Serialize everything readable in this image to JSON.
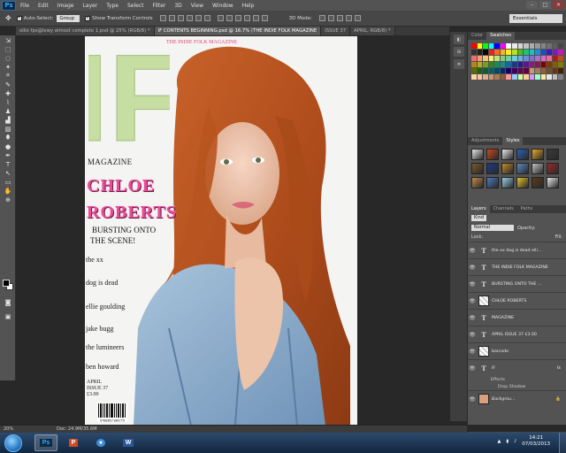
{
  "app": {
    "logo": "Ps",
    "menu": [
      "File",
      "Edit",
      "Image",
      "Layer",
      "Type",
      "Select",
      "Filter",
      "3D",
      "View",
      "Window",
      "Help"
    ],
    "window_controls": [
      "–",
      "□",
      "✕"
    ]
  },
  "options_bar": {
    "auto_select_label": "Auto-Select:",
    "auto_select_value": "Group",
    "show_transform_label": "Show Transform Controls",
    "mode_3d_label": "3D Mode:",
    "workspace": "Essentials"
  },
  "doc_tabs": [
    {
      "label": "ollie fps@lewy  almost complete 1.psd @ 25% (RGB/8) *",
      "active": false
    },
    {
      "label": "IF CONTENTS BEGINNING.psd @ 16.7% (THE INDIE FOLK MAGAZINE",
      "active": true
    },
    {
      "label": "ISSUE 37",
      "active": false
    },
    {
      "label": "APRIL, RGB/8) *",
      "active": false
    }
  ],
  "tools": [
    "⇲",
    "⬚",
    "◌",
    "✦",
    "⌗",
    "✎",
    "✚",
    "⌇",
    "♟",
    "▟",
    "▨",
    "⬮",
    "●",
    "✒",
    "T",
    "↖",
    "▭",
    "✋",
    "⊕"
  ],
  "magazine": {
    "logo_text": "IF",
    "masthead": "MAGAZINE",
    "strapline": "THE INDIE FOLK MAGAZINE",
    "cover_name_1": "CHLOE",
    "cover_name_2": "ROBERTS",
    "bursting_1": "BURSTING ONTO",
    "bursting_2": "THE SCENE!",
    "bands": [
      "the xx",
      "dog is dead",
      "ellie goulding",
      "jake bugg",
      "the lumineers",
      "ben howard"
    ],
    "issue_month": "APRIL",
    "issue_number": "ISSUE 37",
    "price": "£3.00",
    "barcode_number": "9780857186775"
  },
  "status": {
    "zoom": "20%",
    "doc_size": "Doc: 24.9M/35.6M"
  },
  "mini_dock": [
    "◧",
    "⊞",
    "≣"
  ],
  "panels": {
    "color_tabs": [
      "Color",
      "Swatches"
    ],
    "swatch_colors": [
      "#ff0000",
      "#ffff00",
      "#00ff00",
      "#00ffff",
      "#0000ff",
      "#ff00ff",
      "#ffffff",
      "#ebebeb",
      "#d6d6d6",
      "#c2c2c2",
      "#adadad",
      "#999999",
      "#858585",
      "#707070",
      "#5c5c5c",
      "#474747",
      "#333333",
      "#1f1f1f",
      "#000000",
      "#ff1a1a",
      "#ff6b1a",
      "#ffb31a",
      "#fff21a",
      "#b8e31a",
      "#46c21a",
      "#1ac27a",
      "#1ac2c2",
      "#1a8ee3",
      "#1a4ec2",
      "#3a1ac2",
      "#7a1ac2",
      "#c21ab8",
      "#f26c6c",
      "#f5a06c",
      "#f7c46c",
      "#f8ef6c",
      "#c4e27a",
      "#84cf7a",
      "#6ecfa8",
      "#6cd1d1",
      "#6cb1e6",
      "#6c8ed8",
      "#866cd2",
      "#b06cd0",
      "#d86cc2",
      "#e86c9a",
      "#b31a1a",
      "#b3531a",
      "#b3851a",
      "#b3ad1a",
      "#7a9e1a",
      "#2d8a1a",
      "#1a8a56",
      "#1a8a8a",
      "#1a679e",
      "#1a3a8a",
      "#2c1a8a",
      "#561a8a",
      "#8a1a82",
      "#8a1a52",
      "#800000",
      "#803c00",
      "#806000",
      "#807c00",
      "#566f00",
      "#1f6100",
      "#00613c",
      "#006161",
      "#004a6f",
      "#002a61",
      "#1e0061",
      "#3c0061",
      "#61005a",
      "#610039",
      "#c69c6d",
      "#a67c52",
      "#8c6239",
      "#754c24",
      "#603913",
      "#42210b",
      "#ffd5a6",
      "#f5c69e",
      "#e0b08a",
      "#c8966e",
      "#a87a55",
      "#8a5f3e",
      "#ff9999",
      "#99ccff",
      "#ccff99",
      "#ffcc99",
      "#cc99ff",
      "#99ffcc",
      "#ffe699",
      "#e6e6e6",
      "#bfbfbf",
      "#808080"
    ],
    "styles_tabs": [
      "Adjustments",
      "Styles"
    ],
    "style_colors": [
      "#e8e8e8",
      "#d2451e",
      "#e8e8e8",
      "#2a62b5",
      "#e8a82a",
      "#3a3a3a",
      "#7a5a2a",
      "#1a3a8a",
      "#c28a2a",
      "#5a8ac2",
      "#c2c2c2",
      "#9a2a2a",
      "#c28a4a",
      "#4a7ac2",
      "#9ad2e8",
      "#e8c22a",
      "#5a3a1a",
      "#e8e8e8"
    ],
    "layers_tabs": [
      "Layers",
      "Channels",
      "Paths"
    ],
    "layer_filter": "Kind",
    "blend_mode": "Normal",
    "opacity_label": "Opacity:",
    "lock_label": "Lock:",
    "fill_label": "Fill:",
    "layers": [
      {
        "name": "the xx  dog is dead  elli...",
        "type": "text"
      },
      {
        "name": "THE INDIE FOLK MAGAZINE",
        "type": "text"
      },
      {
        "name": "BURSTING ONTO THE ...",
        "type": "text"
      },
      {
        "name": "CHLOE ROBERTS",
        "type": "checker"
      },
      {
        "name": "MAGAZINE",
        "type": "text"
      },
      {
        "name": "APRIL ISSUE 37 £3.00",
        "type": "text"
      },
      {
        "name": "barcode",
        "type": "checker"
      },
      {
        "name": "IF",
        "type": "text",
        "fx": "fx"
      }
    ],
    "effects_label": "Effects",
    "drop_shadow_label": "Drop Shadow",
    "background_layer": "Backgrou..."
  },
  "taskbar": {
    "apps": [
      {
        "label": "Ps",
        "color": "#31a8ff",
        "bg": "#0f2b44"
      },
      {
        "label": "P",
        "color": "#ffffff",
        "bg": "#d24726"
      },
      {
        "label": "●",
        "color": "#ffffff",
        "bg": "#3d8ed6"
      },
      {
        "label": "W",
        "color": "#ffffff",
        "bg": "#2b579a"
      }
    ],
    "time": "14:21",
    "date": "07/03/2013"
  }
}
